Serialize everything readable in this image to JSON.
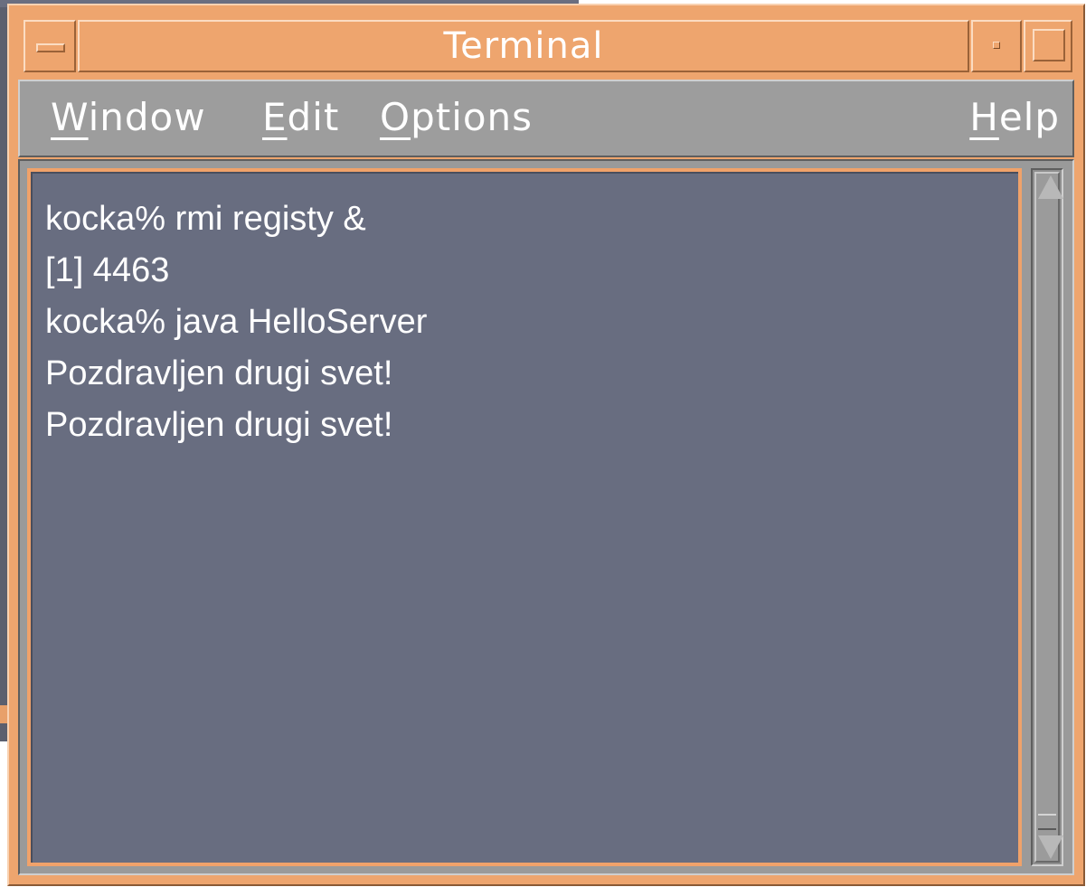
{
  "window": {
    "title": "Terminal"
  },
  "menubar": {
    "items": [
      {
        "mnemonic": "W",
        "rest": "indow"
      },
      {
        "mnemonic": "E",
        "rest": "dit"
      },
      {
        "mnemonic": "O",
        "rest": "ptions"
      },
      {
        "mnemonic": "H",
        "rest": "elp"
      }
    ]
  },
  "terminal": {
    "lines": [
      "kocka% rmi registy &",
      "[1] 4463",
      "kocka% java HelloServer",
      "Pozdravljen drugi svet!",
      "Pozdravljen drugi svet!"
    ]
  },
  "colors": {
    "frame": "#eea56e",
    "menubar": "#9d9d9d",
    "terminal_bg": "#686d80",
    "text": "#ffffff"
  },
  "icons": {
    "window_menu": "window-menu-icon",
    "minimize": "minimize-icon",
    "maximize": "maximize-icon",
    "scroll_up": "scroll-up-arrow-icon",
    "scroll_down": "scroll-down-arrow-icon"
  }
}
